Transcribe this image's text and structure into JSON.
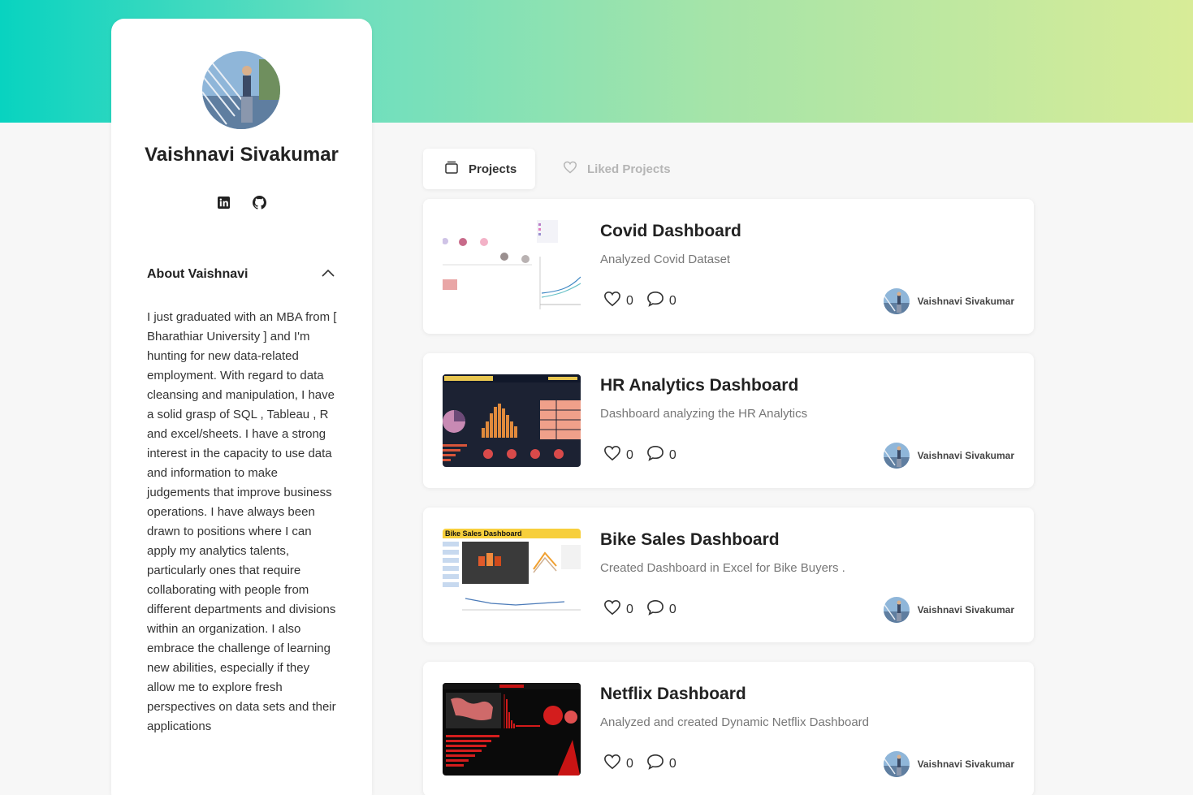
{
  "profile": {
    "name": "Vaishnavi Sivakumar",
    "social": [
      "linkedin-icon",
      "github-icon"
    ],
    "about_title": "About Vaishnavi",
    "about_text": "I just graduated with an MBA from [ Bharathiar University ] and I'm hunting for new data-related employment. With regard to data cleansing and manipulation, I have a solid grasp of SQL , Tableau , R and excel/sheets. I have a strong interest in the capacity to use data and information to make judgements that improve business operations. I have always been drawn to positions where I can apply my analytics talents, particularly ones that require collaborating with people from different departments and divisions within an organization. I also embrace the challenge of learning new abilities, especially if they allow me to explore fresh perspectives on data sets and their applications"
  },
  "tabs": {
    "projects": "Projects",
    "liked": "Liked Projects"
  },
  "projects": [
    {
      "title": "Covid Dashboard",
      "description": "Analyzed Covid Dataset",
      "likes": "0",
      "comments": "0",
      "author": "Vaishnavi Sivakumar"
    },
    {
      "title": "HR Analytics Dashboard",
      "description": "Dashboard analyzing the HR Analytics",
      "likes": "0",
      "comments": "0",
      "author": "Vaishnavi Sivakumar"
    },
    {
      "title": "Bike Sales Dashboard",
      "description": "Created Dashboard in Excel for Bike Buyers .",
      "likes": "0",
      "comments": "0",
      "author": "Vaishnavi Sivakumar",
      "thumb_heading": "Bike Sales Dashboard"
    },
    {
      "title": "Netflix Dashboard",
      "description": "Analyzed and created Dynamic Netflix Dashboard",
      "likes": "0",
      "comments": "0",
      "author": "Vaishnavi Sivakumar"
    }
  ],
  "colors": {
    "banner_start": "#08d3c0",
    "banner_end": "#d8ec98",
    "card": "#ffffff",
    "background": "#f7f7f7"
  }
}
